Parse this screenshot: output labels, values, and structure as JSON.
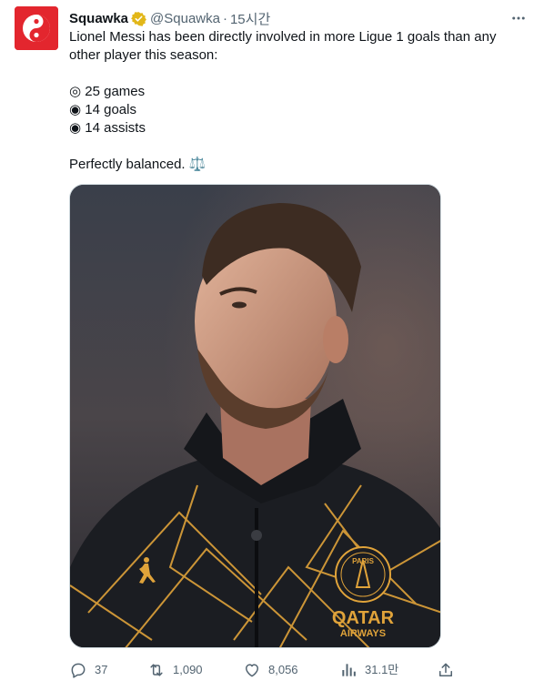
{
  "tweet": {
    "display_name": "Squawka",
    "handle": "@Squawka",
    "separator": "·",
    "time": "15시간",
    "text_line1": "Lionel Messi has been directly involved in more Ligue 1 goals than any other player this season:",
    "stat_games": "◎ 25 games",
    "stat_goals": "◉ 14 goals",
    "stat_assists": "◉ 14 assists",
    "closing": "Perfectly balanced. ⚖️",
    "media_text": {
      "jersey_badge": "PARIS",
      "sponsor_line1": "QATAR",
      "sponsor_line2": "AIRWAYS"
    }
  },
  "actions": {
    "replies": "37",
    "retweets": "1,090",
    "likes": "8,056",
    "views": "31.1만"
  },
  "icons": {
    "avatar": "squawka-logo-icon",
    "verified": "verified-badge-icon",
    "more": "more-icon",
    "reply": "reply-icon",
    "retweet": "retweet-icon",
    "like": "heart-icon",
    "views": "views-icon",
    "share": "share-icon"
  },
  "colors": {
    "brand_red": "#e3262e",
    "verified_gold": "#e2b719",
    "muted_text": "#536471"
  }
}
